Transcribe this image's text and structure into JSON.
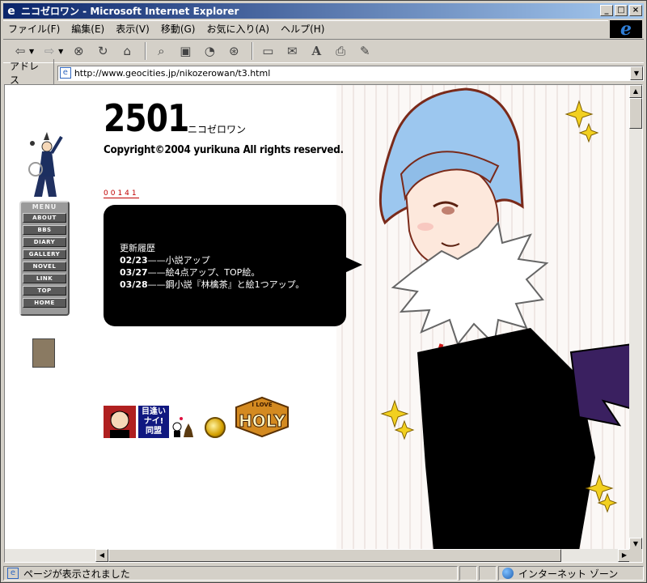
{
  "window": {
    "title": "ニコゼロワン - Microsoft Internet Explorer",
    "controls": {
      "minimize": "_",
      "maximize": "□",
      "close": "×"
    }
  },
  "menu": [
    "ファイル(F)",
    "編集(E)",
    "表示(V)",
    "移動(G)",
    "お気に入り(A)",
    "ヘルプ(H)"
  ],
  "toolbar": {
    "icons": [
      "back-arrow-icon",
      "forward-arrow-icon",
      "stop-icon",
      "refresh-icon",
      "home-icon",
      "search-icon",
      "favorites-icon",
      "history-icon",
      "channels-icon",
      "fullscreen-icon",
      "mail-icon",
      "font-icon",
      "print-icon",
      "edit-icon"
    ]
  },
  "address": {
    "label": "アドレス",
    "url": "http://www.geocities.jp/nikozerowan/t3.html"
  },
  "page": {
    "title": "2501",
    "subtitle": "ニコゼロワン",
    "copyright": "Copyright©2004 yurikuna All rights reserved.",
    "counter": "00141",
    "news_heading": "更新履歴",
    "news": [
      {
        "date": "02/23",
        "text": "——小説アップ"
      },
      {
        "date": "03/27",
        "text": "——絵4点アップ、TOP絵。"
      },
      {
        "date": "03/28",
        "text": "——鋼小説『林檎茶』と絵1つアップ。"
      }
    ],
    "nav_heading": "MENU",
    "nav": [
      "ABOUT",
      "BBS",
      "DIARY",
      "GALLERY",
      "NOVEL",
      "LINK",
      "TOP",
      "HOME"
    ],
    "banner_b_text": "目逢い\nナイ!\n同盟",
    "holy_text": "HOLY",
    "holy_top": "I LOVE"
  },
  "status": {
    "text": "ページが表示されました",
    "zone": "インターネット ゾーン"
  },
  "colors": {
    "title_bar_start": "#0a246a",
    "title_bar_end": "#a6caf0",
    "chrome": "#d4d0c8",
    "bubble": "#000000"
  }
}
